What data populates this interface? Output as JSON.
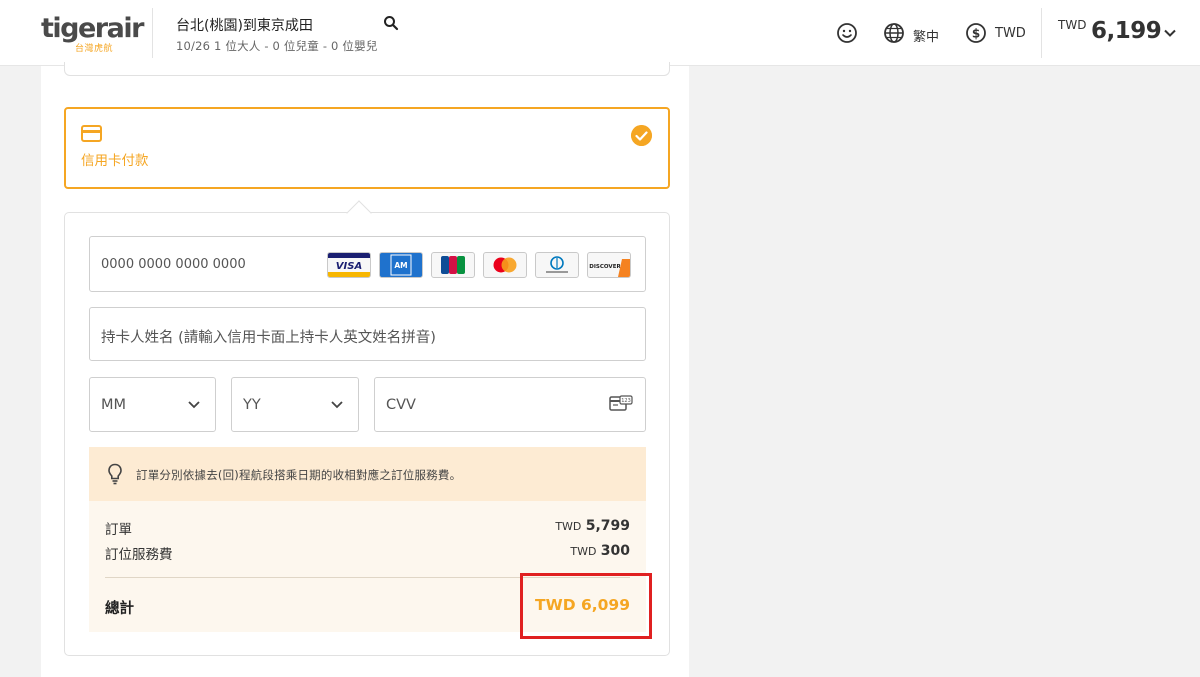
{
  "header": {
    "logo_text_a": "tiger",
    "logo_text_b": "air",
    "logo_sub": "台灣虎航",
    "route": "台北(桃園)到東京成田",
    "route_details": "10/26  1 位大人 - 0 位兒童 - 0 位嬰兒",
    "language": "繁中",
    "currency": "TWD",
    "price_currency": "TWD",
    "price_value": "6,199"
  },
  "payment": {
    "method_label": "信用卡付款",
    "selected": true,
    "card_number_placeholder": "0000 0000 0000 0000",
    "card_brands": [
      "VISA",
      "AMEX",
      "JCB",
      "Mastercard",
      "Diners Club",
      "DISCOVER"
    ],
    "holder_placeholder": "持卡人姓名 (請輸入信用卡面上持卡人英文姓名拼音)",
    "month_placeholder": "MM",
    "year_placeholder": "YY",
    "cvv_placeholder": "CVV"
  },
  "notice": {
    "text": "訂單分別依據去(回)程航段搭乘日期的收相對應之訂位服務費。"
  },
  "summary": {
    "rows": [
      {
        "label": "訂單",
        "currency": "TWD",
        "amount": "5,799"
      },
      {
        "label": "訂位服務費",
        "currency": "TWD",
        "amount": "300"
      }
    ],
    "total_label": "總計",
    "total_amount": "TWD 6,099"
  },
  "colors": {
    "accent": "#f5a623",
    "highlight": "#e02020",
    "notice_bg": "#fdebd3",
    "summary_bg": "#fdf7ee"
  }
}
